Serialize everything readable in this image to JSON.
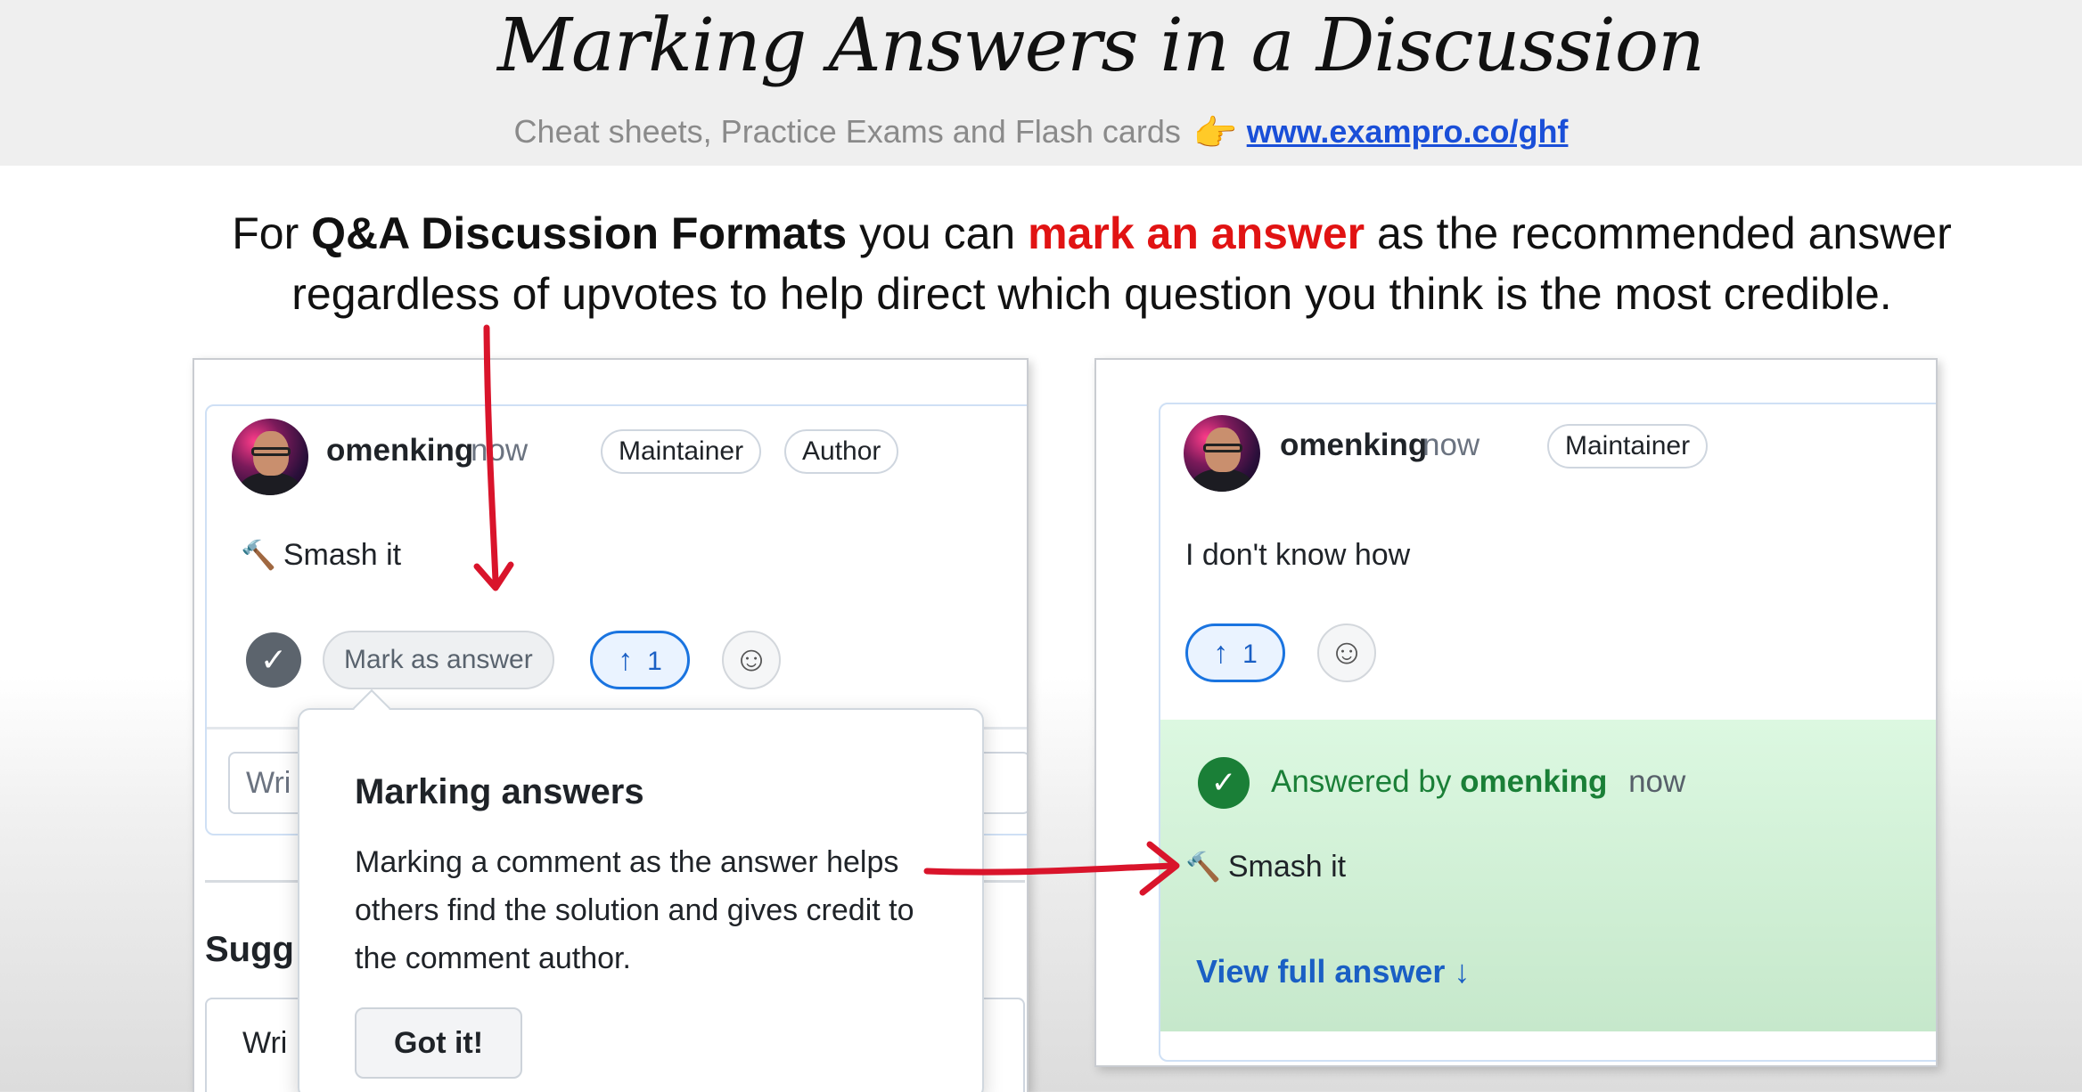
{
  "slide": {
    "title": "Marking Answers in a Discussion",
    "subtitle_text": "Cheat sheets, Practice Exams and Flash cards",
    "hand_emoji": "👉",
    "link_text": "www.exampro.co/ghf"
  },
  "description": {
    "part1": "For ",
    "bold1": "Q&A Discussion Formats",
    "part2": " you can ",
    "red": "mark an answer",
    "part3": " as the recommended answer regardless of upvotes to help direct which question you think is the most credible."
  },
  "left_panel": {
    "username": "omenking",
    "timestamp": "now",
    "badges": [
      "Maintainer",
      "Author"
    ],
    "hammer_emoji": "🔨",
    "comment_text": "Smash it",
    "check_icon": "✓",
    "mark_answer_label": "Mark as answer",
    "upvote_arrow": "↑",
    "upvote_count": "1",
    "emoji_icon": "☺",
    "write_placeholder_top": "Wri",
    "suggest_label": "Sugg",
    "write_placeholder_bottom": "Wri"
  },
  "popover": {
    "title": "Marking answers",
    "body": "Marking a comment as the answer helps others find the solution and gives credit to the comment author.",
    "button_label": "Got it!"
  },
  "right_panel": {
    "username": "omenking",
    "timestamp": "now",
    "badge": "Maintainer",
    "comment_text": "I don't know how",
    "upvote_arrow": "↑",
    "upvote_count": "1",
    "emoji_icon": "☺",
    "answered_prefix": "Answered by",
    "answered_user": "omenking",
    "answered_time": "now",
    "answered_check": "✓",
    "answer_hammer": "🔨",
    "answer_text": "Smash it",
    "view_full_label": "View full answer ↓"
  },
  "colors": {
    "accent_red": "#e11313",
    "link_blue": "#1a4fd8",
    "answer_green": "#1a7f37",
    "answer_bg": "#dcf8e1"
  }
}
